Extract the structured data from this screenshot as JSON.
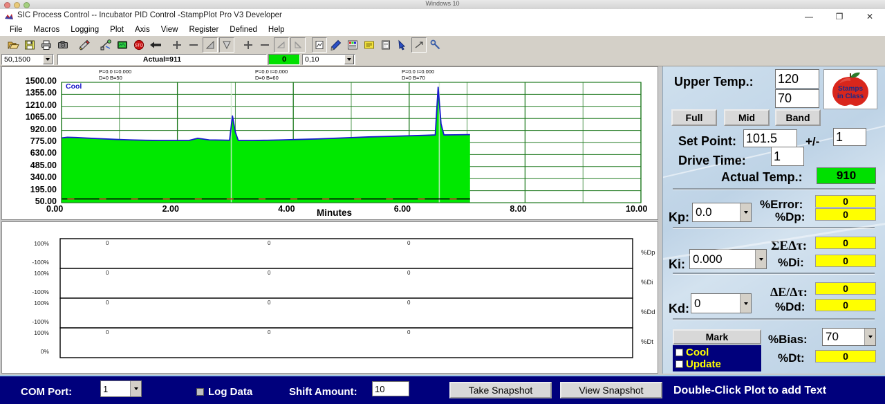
{
  "vm": {
    "title": "Windows 10"
  },
  "window": {
    "title": "SIC Process Control -- Incubator PID Control -StampPlot Pro V3 Developer",
    "minimize": "—",
    "maximize": "❐",
    "close": "✕"
  },
  "menu": {
    "items": [
      {
        "label": "File",
        "name": "menu-file"
      },
      {
        "label": "Macros",
        "name": "menu-macros"
      },
      {
        "label": "Logging",
        "name": "menu-logging"
      },
      {
        "label": "Plot",
        "name": "menu-plot"
      },
      {
        "label": "Axis",
        "name": "menu-axis"
      },
      {
        "label": "View",
        "name": "menu-view"
      },
      {
        "label": "Register",
        "name": "menu-register"
      },
      {
        "label": "Defined",
        "name": "menu-defined"
      },
      {
        "label": "Help",
        "name": "menu-help"
      }
    ]
  },
  "toolbar": {
    "icons": [
      "open-folder-icon",
      "save-disk-icon",
      "print-icon",
      "camera-icon",
      "wand-icon",
      "connect-icon",
      "display-icon",
      "stop-icon",
      "back-arrow-icon",
      "plus-icon",
      "minus-icon",
      "scale-up-icon",
      "scale-down-icon",
      "plus-time-icon",
      "minus-time-icon",
      "zoom-in-time-icon",
      "zoom-out-time-icon",
      "pdf-icon",
      "pen-icon",
      "palette-icon",
      "notes-icon",
      "clipboard-icon",
      "pointer-icon",
      "expand-icon",
      "wrench-icon"
    ],
    "range_combo": "50,1500",
    "status_text": "Actual=911",
    "green_value": "0",
    "time_combo": "0,10"
  },
  "main_plot": {
    "cool_label": "Cool",
    "x_title": "Minutes",
    "annotations": [
      {
        "line1": "P=0.0 I=0.000",
        "line2": "D=0 B=50"
      },
      {
        "line1": "P=0.0 I=0.000",
        "line2": "D=0 B=60"
      },
      {
        "line1": "P=0.0 I=0.000",
        "line2": "D=0 B=70"
      }
    ]
  },
  "sub_plots": {
    "rows": [
      {
        "top": "100%",
        "bottom": "-100%",
        "right": "%Dp",
        "marks": [
          "0",
          "0",
          "0"
        ]
      },
      {
        "top": "100%",
        "bottom": "-100%",
        "right": "%Di",
        "marks": [
          "0",
          "0",
          "0"
        ]
      },
      {
        "top": "100%",
        "bottom": "-100%",
        "right": "%Dd",
        "marks": [
          "0",
          "0",
          "0"
        ]
      },
      {
        "top": "100%",
        "bottom": "0%",
        "right": "%Dt",
        "marks": [
          "0",
          "0",
          "0"
        ]
      }
    ]
  },
  "panel": {
    "upper_temp_label": "Upper Temp.:",
    "upper_temp_value": "120",
    "lower_temp_value": "70",
    "buttons": {
      "full": "Full",
      "mid": "Mid",
      "band": "Band"
    },
    "set_point_label": "Set Point:",
    "set_point_value": "101.5",
    "plus_minus_label": "+/-",
    "plus_minus_value": "1",
    "drive_time_label": "Drive Time:",
    "drive_time_value": "1",
    "actual_temp_label": "Actual Temp.:",
    "actual_temp_value": "910",
    "kp_label": "Kp:",
    "kp_value": "0.0",
    "ki_label": "Ki:",
    "ki_value": "0.000",
    "kd_label": "Kd:",
    "kd_value": "0",
    "error_label": "%Error:",
    "error_value": "0",
    "dp_label": "%Dp:",
    "dp_value": "0",
    "sum_label": "ΣEΔτ:",
    "sum_value": "0",
    "di_label": "%Di:",
    "di_value": "0",
    "delta_label": "ΔE/Δτ:",
    "delta_value": "0",
    "dd_label": "%Dd:",
    "dd_value": "0",
    "mark_label": "Mark",
    "cool_label": "Cool",
    "update_label": "Update",
    "bias_label": "%Bias:",
    "bias_value": "70",
    "dt_label": "%Dt:",
    "dt_value": "0",
    "logo_line1": "Stamps",
    "logo_line2": "in Class"
  },
  "bottom": {
    "com_port_label": "COM Port:",
    "com_port_value": "1",
    "log_data_label": "Log Data",
    "shift_amount_label": "Shift Amount:",
    "shift_amount_value": "10",
    "take_snapshot": "Take Snapshot",
    "view_snapshot": "View Snapshot",
    "note": "Double-Click Plot to add Text"
  },
  "colors": {
    "plot_fill": "#00e800",
    "trace": "#1818d0",
    "grid": "#1f7a1f",
    "navy": "#00007c",
    "yellow_field": "#ffff00",
    "green_field": "#00e000"
  },
  "chart_data": {
    "type": "area",
    "title": "Incubator PID Control",
    "xlabel": "Minutes",
    "ylabel": "",
    "xlim": [
      0,
      10
    ],
    "ylim": [
      50,
      1500
    ],
    "yticks": [
      "50.00",
      "195.00",
      "340.00",
      "485.00",
      "630.00",
      "775.00",
      "920.00",
      "1065.00",
      "1210.00",
      "1355.00",
      "1500.00"
    ],
    "xticks": [
      "0.00",
      "2.00",
      "4.00",
      "6.00",
      "8.00",
      "10.00"
    ],
    "grid": true,
    "legend": [
      "Cool"
    ],
    "series": [
      {
        "name": "Cool",
        "color": "#1818d0",
        "fill": "#00e800",
        "x": [
          0.0,
          0.1,
          0.25,
          0.45,
          0.7,
          0.95,
          1.2,
          1.45,
          1.7,
          1.95,
          2.2,
          2.35,
          2.55,
          2.75,
          2.9,
          2.95,
          3.0,
          3.05,
          3.1,
          3.3,
          3.55,
          3.8,
          4.1,
          4.4,
          4.7,
          5.0,
          5.3,
          5.6,
          5.9,
          6.1,
          6.3,
          6.45,
          6.5,
          6.55,
          6.6,
          6.8,
          7.0,
          7.05
        ],
        "y": [
          830,
          838,
          835,
          828,
          820,
          812,
          806,
          802,
          800,
          800,
          800,
          826,
          806,
          804,
          802,
          1095,
          900,
          800,
          800,
          800,
          802,
          806,
          812,
          818,
          826,
          834,
          842,
          848,
          854,
          858,
          862,
          866,
          1440,
          1000,
          866,
          868,
          870,
          870
        ]
      },
      {
        "name": "baseline",
        "color": "#000000",
        "x": [
          0.0,
          7.05
        ],
        "y": [
          95,
          95
        ]
      }
    ],
    "annotations": [
      {
        "x": 1.45,
        "text": "P=0.0 I=0.000 / D=0 B=50"
      },
      {
        "x": 4.3,
        "text": "P=0.0 I=0.000 / D=0 B=60"
      },
      {
        "x": 6.7,
        "text": "P=0.0 I=0.000 / D=0 B=70"
      }
    ],
    "sub_charts": [
      {
        "label": "%Dp",
        "ylim": [
          -100,
          100
        ],
        "values": [
          0,
          0,
          0
        ]
      },
      {
        "label": "%Di",
        "ylim": [
          -100,
          100
        ],
        "values": [
          0,
          0,
          0
        ]
      },
      {
        "label": "%Dd",
        "ylim": [
          -100,
          100
        ],
        "values": [
          0,
          0,
          0
        ]
      },
      {
        "label": "%Dt",
        "ylim": [
          0,
          100
        ],
        "values": [
          0,
          0,
          0
        ]
      }
    ]
  }
}
